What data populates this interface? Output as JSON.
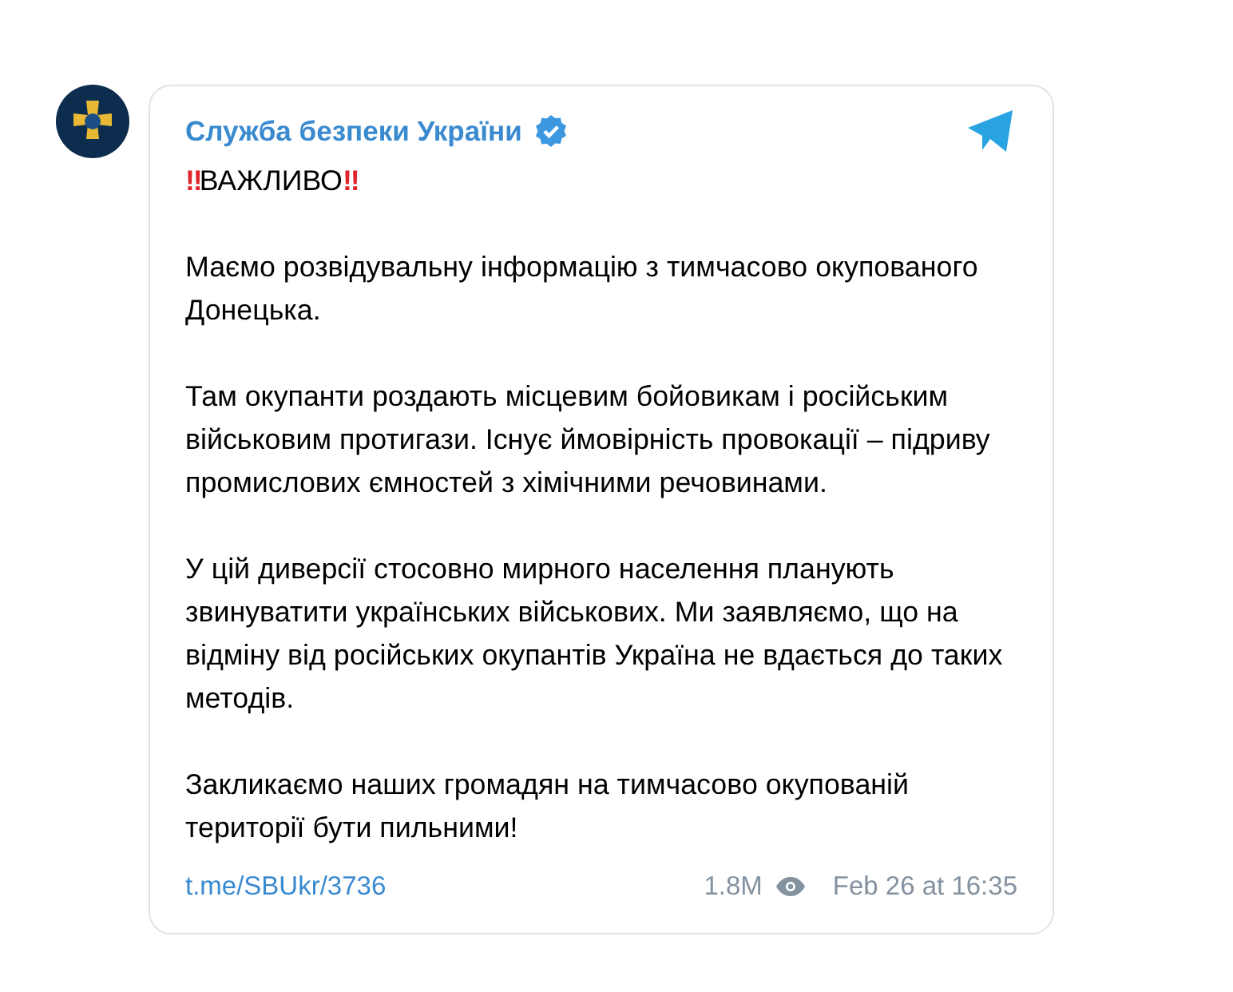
{
  "channel": {
    "name": "Служба безпеки України",
    "verified": true
  },
  "headline": [
    {
      "kind": "emoji",
      "text": "‼"
    },
    {
      "kind": "text",
      "text": "ВАЖЛИВО"
    },
    {
      "kind": "emoji",
      "text": "‼"
    }
  ],
  "paragraphs": [
    "Маємо розвідувальну інформацію з тимчасово окупованого Донецька.",
    "Там окупанти роздають місцевим бойовикам і російським військовим протигази. Існує ймовірність провокації – підриву промислових ємностей з хімічними речовинами.",
    "У цій диверсії стосовно мирного населення планують звинуватити українських військових. Ми заявляємо, що на відміну від російських окупантів Україна не вдається до таких методів.",
    "Закликаємо наших громадян на тимчасово окупованій території бути пильними!"
  ],
  "footer": {
    "link": "t.me/SBUkr/3736",
    "views": "1.8M",
    "date": "Feb 26 at 16:35"
  }
}
